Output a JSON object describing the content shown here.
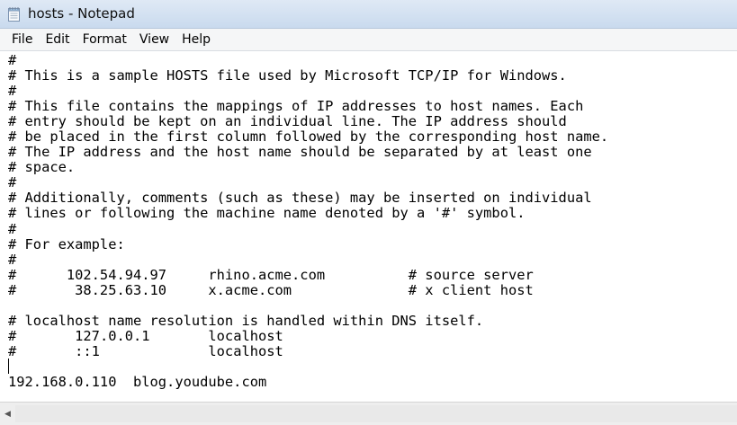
{
  "window": {
    "title": "hosts - Notepad"
  },
  "menu": [
    {
      "label": "File"
    },
    {
      "label": "Edit"
    },
    {
      "label": "Format"
    },
    {
      "label": "View"
    },
    {
      "label": "Help"
    }
  ],
  "editor": {
    "lines": [
      "#",
      "# This is a sample HOSTS file used by Microsoft TCP/IP for Windows.",
      "#",
      "# This file contains the mappings of IP addresses to host names. Each",
      "# entry should be kept on an individual line. The IP address should",
      "# be placed in the first column followed by the corresponding host name.",
      "# The IP address and the host name should be separated by at least one",
      "# space.",
      "#",
      "# Additionally, comments (such as these) may be inserted on individual",
      "# lines or following the machine name denoted by a '#' symbol.",
      "#",
      "# For example:",
      "#",
      "#      102.54.94.97     rhino.acme.com          # source server",
      "#       38.25.63.10     x.acme.com              # x client host",
      "",
      "# localhost name resolution is handled within DNS itself.",
      "#\t127.0.0.1       localhost",
      "#\t::1             localhost",
      "",
      "192.168.0.110  blog.youdube.com"
    ]
  },
  "icons": {
    "app": "notepad-icon",
    "scroll_left": "scroll-left-arrow-icon"
  },
  "colors": {
    "titlebar": "#dfe9f5",
    "menubar": "#f5f6f7",
    "editor_bg": "#ffffff",
    "text": "#000000"
  }
}
